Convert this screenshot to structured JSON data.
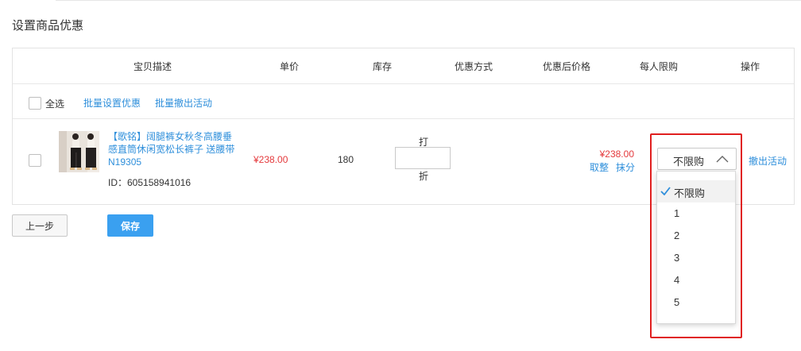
{
  "page": {
    "title": "设置商品优惠"
  },
  "table": {
    "headers": [
      "宝贝描述",
      "单价",
      "库存",
      "优惠方式",
      "优惠后价格",
      "每人限购",
      "操作"
    ]
  },
  "bulk": {
    "select_all": "全选",
    "batch_set": "批量设置优惠",
    "batch_cancel": "批量撤出活动"
  },
  "item": {
    "title": "【歌铭】阔腿裤女秋冬高腰垂感直筒休闲宽松长裤子 送腰带N19305",
    "id_text": "ID：605158941016",
    "price": "¥238.00",
    "stock": "180",
    "discount_prefix": "打",
    "discount_suffix": "折",
    "discount_value": "",
    "after_price": "¥238.00",
    "round": "取整",
    "drop": "抹分",
    "limit_selected": "不限购",
    "action": "撤出活动"
  },
  "limit_dropdown": {
    "options": [
      "不限购",
      "1",
      "2",
      "3",
      "4",
      "5"
    ],
    "selected_index": 0
  },
  "footer": {
    "prev_label": "上一步",
    "save_label": "保存"
  },
  "colors": {
    "link": "#2f8fdb",
    "price": "#e4393c",
    "primary_button": "#3aa0f0",
    "highlight": "#e01f1f",
    "check": "#2f8fdb"
  },
  "icons": {
    "select_chevron": "chevron-up-icon",
    "selected_option": "checkmark-icon"
  }
}
